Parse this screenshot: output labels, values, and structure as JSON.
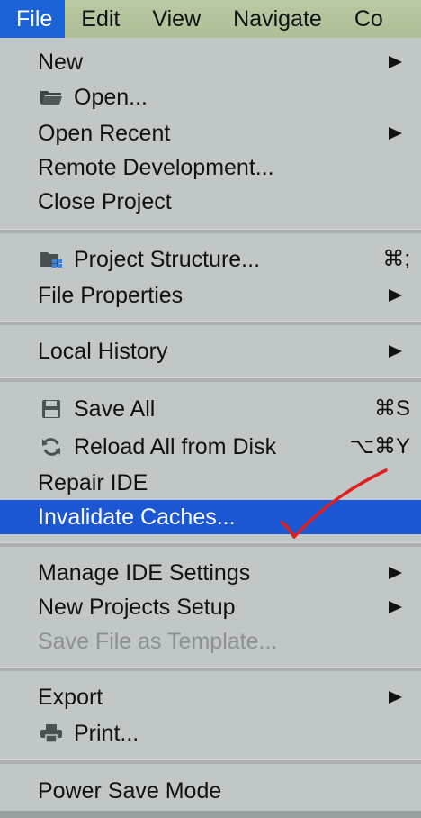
{
  "menubar": {
    "items": [
      "File",
      "Edit",
      "View",
      "Navigate",
      "Co"
    ]
  },
  "file_menu": {
    "new": "New",
    "open": "Open...",
    "open_recent": "Open Recent",
    "remote_development": "Remote Development...",
    "close_project": "Close Project",
    "project_structure": "Project Structure...",
    "project_structure_shortcut": "⌘;",
    "file_properties": "File Properties",
    "local_history": "Local History",
    "save_all": "Save All",
    "save_all_shortcut": "⌘S",
    "reload_all": "Reload All from Disk",
    "reload_all_shortcut": "⌥⌘Y",
    "repair_ide": "Repair IDE",
    "invalidate_caches": "Invalidate Caches...",
    "manage_ide_settings": "Manage IDE Settings",
    "new_projects_setup": "New Projects Setup",
    "save_file_as_template": "Save File as Template...",
    "export": "Export",
    "print": "Print...",
    "power_save_mode": "Power Save Mode"
  },
  "icons": {
    "open": "folder-icon",
    "project_structure": "project-structure-icon",
    "save_all": "save-icon",
    "reload_all": "reload-icon",
    "print": "printer-icon"
  },
  "colors": {
    "highlight": "#1b57d3",
    "menu_bg": "#c1c6c6",
    "annotation": "#e0201f"
  }
}
